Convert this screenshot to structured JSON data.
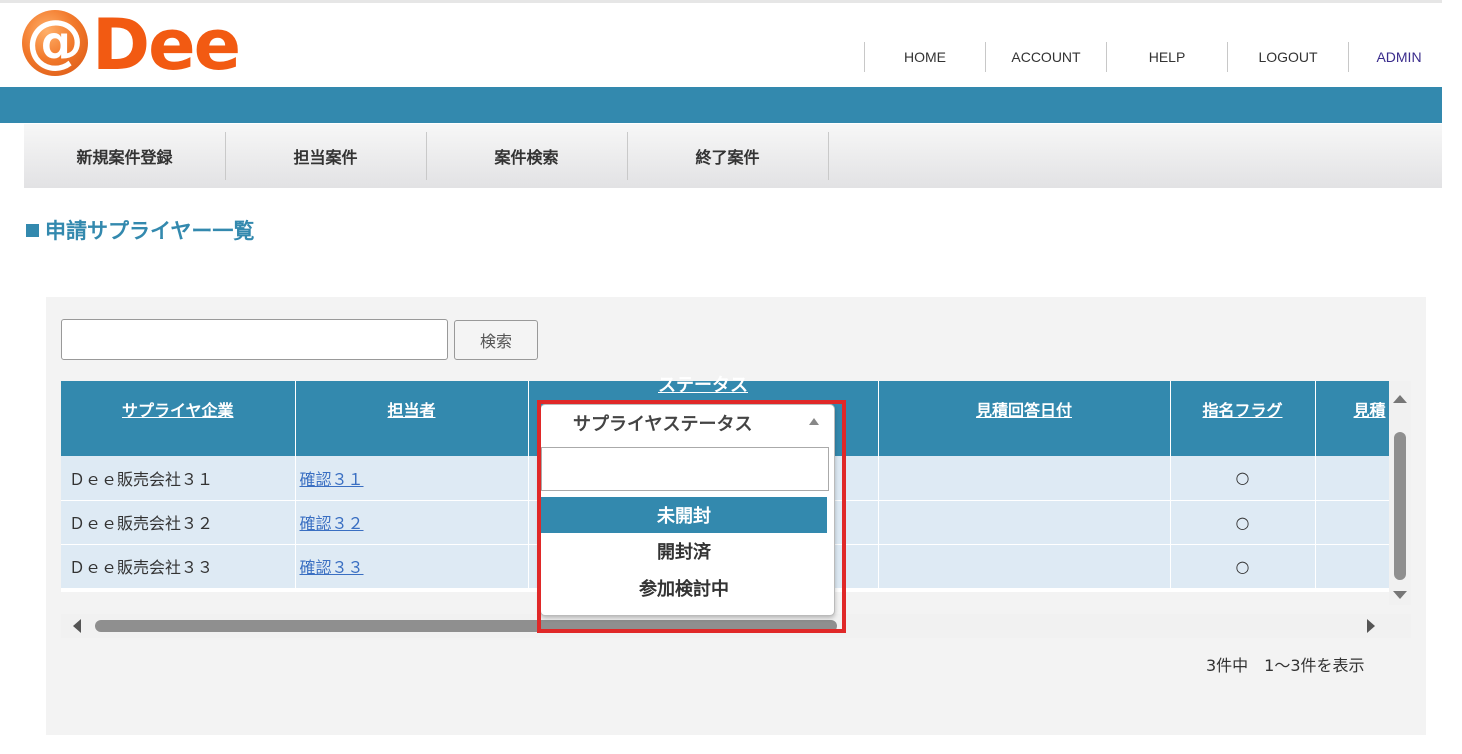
{
  "brand": {
    "mark": "@",
    "name": "Dee"
  },
  "topnav": [
    "HOME",
    "ACCOUNT",
    "HELP",
    "LOGOUT",
    "ADMIN"
  ],
  "menu": [
    "新規案件登録",
    "担当案件",
    "案件検索",
    "終了案件"
  ],
  "page_title": "申請サプライヤー一覧",
  "search": {
    "value": "",
    "button_label": "検索"
  },
  "table": {
    "columns": [
      "サプライヤ企業",
      "担当者",
      "ステータス",
      "見積回答日付",
      "指名フラグ",
      "見積"
    ],
    "rows": [
      {
        "company": "Ｄｅｅ販売会社３１",
        "contact": "確認３１",
        "flag": "○"
      },
      {
        "company": "Ｄｅｅ販売会社３２",
        "contact": "確認３２",
        "flag": "○"
      },
      {
        "company": "Ｄｅｅ販売会社３３",
        "contact": "確認３３",
        "flag": "○"
      }
    ]
  },
  "dropdown": {
    "title": "サプライヤステータス",
    "search_value": "",
    "options": [
      "未開封",
      "開封済",
      "参加検討中"
    ],
    "selected": "未開封"
  },
  "pager": "3件中　1～3件を表示",
  "colors": {
    "accent": "#3389ae",
    "logo_orange": "#f25a12",
    "highlight": "#e02828",
    "row_bg": "#deeaf4"
  }
}
